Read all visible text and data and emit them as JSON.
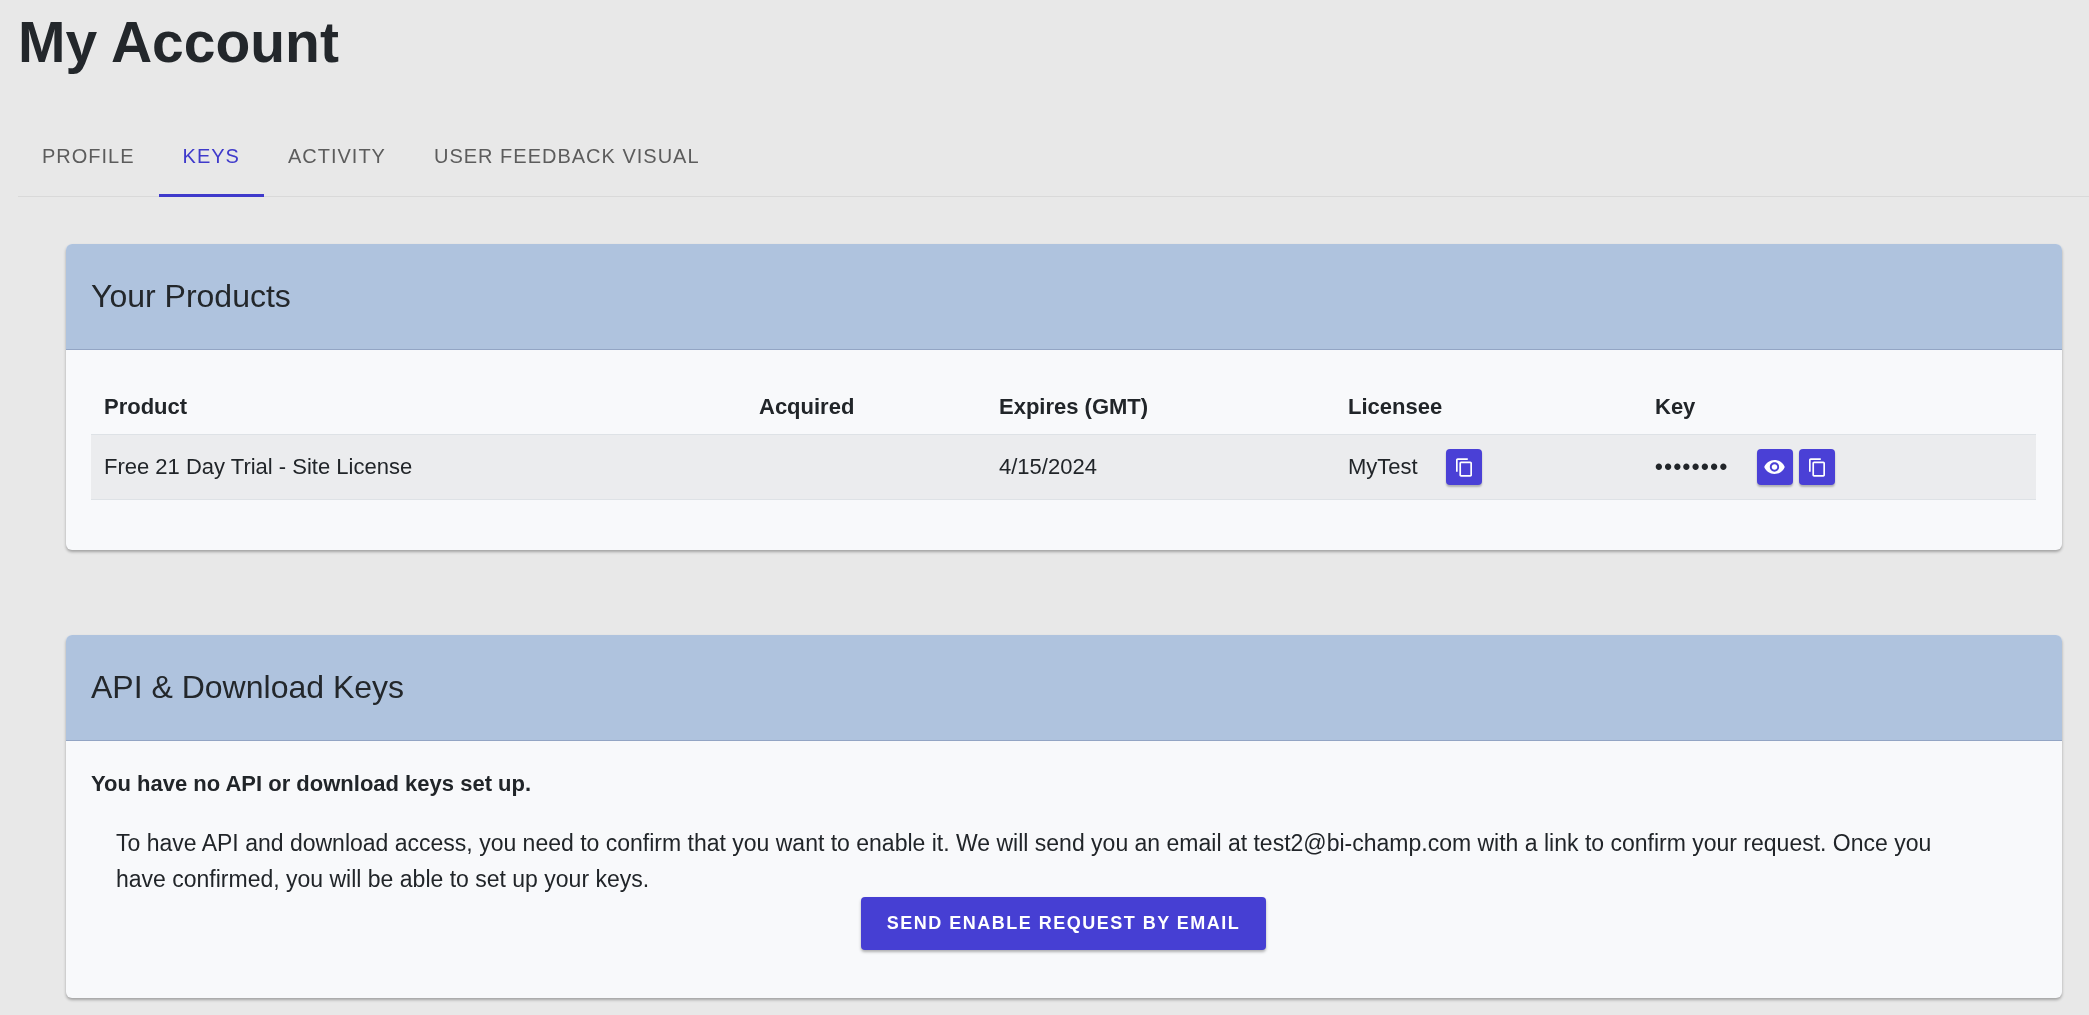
{
  "page": {
    "title": "My Account"
  },
  "tabs": [
    {
      "label": "PROFILE",
      "selected": false
    },
    {
      "label": "KEYS",
      "selected": true
    },
    {
      "label": "ACTIVITY",
      "selected": false
    },
    {
      "label": "USER FEEDBACK VISUAL",
      "selected": false
    }
  ],
  "products": {
    "title": "Your Products",
    "table": {
      "columns": [
        "Product",
        "Acquired",
        "Expires (GMT)",
        "Licensee",
        "Key"
      ],
      "rows": [
        {
          "product": "Free 21 Day Trial - Site License",
          "expires": "4/15/2024",
          "licensee": "MyTest",
          "key": "••••••••"
        }
      ]
    }
  },
  "api_keys": {
    "title": "API & Download Keys",
    "notice": "You have no API or download keys set up.",
    "description": "To have API and download access, you need to confirm that you want to enable it. We will send you an email at test2@bi-champ.com with a link to confirm your request. Once you have confirmed, you will be able to set up your keys.",
    "button": "SEND ENABLE REQUEST BY EMAIL"
  }
}
